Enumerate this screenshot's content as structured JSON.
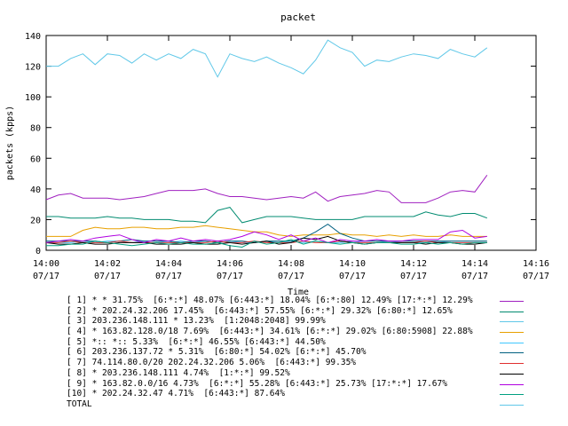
{
  "chart_data": {
    "type": "line",
    "title": "packet",
    "xlabel": "Time",
    "ylabel": "packets (kpps)",
    "ylim": [
      0,
      140
    ],
    "yticks": [
      0,
      20,
      40,
      60,
      80,
      100,
      120,
      140
    ],
    "xticks": [
      {
        "time": "14:00",
        "date": "07/17"
      },
      {
        "time": "14:02",
        "date": "07/17"
      },
      {
        "time": "14:04",
        "date": "07/17"
      },
      {
        "time": "14:06",
        "date": "07/17"
      },
      {
        "time": "14:08",
        "date": "07/17"
      },
      {
        "time": "14:10",
        "date": "07/17"
      },
      {
        "time": "14:12",
        "date": "07/17"
      },
      {
        "time": "14:14",
        "date": "07/17"
      },
      {
        "time": "14:16",
        "date": "07/17"
      }
    ],
    "x_minutes": [
      0,
      0.4,
      0.8,
      1.2,
      1.6,
      2,
      2.4,
      2.8,
      3.2,
      3.6,
      4,
      4.4,
      4.8,
      5.2,
      5.6,
      6,
      6.4,
      6.8,
      7.2,
      7.6,
      8,
      8.4,
      8.8,
      9.2,
      9.6,
      10,
      10.4,
      10.8,
      11.2,
      11.6,
      12,
      12.4,
      12.8,
      13.2,
      13.6,
      14,
      14.4
    ],
    "grid": false,
    "legend_position": "bottom",
    "series": [
      {
        "name": "[ 1] * * 31.75%  [6:*:*] 48.07% [6:443:*] 18.04% [6:*:80] 12.49% [17:*:*] 12.29%",
        "color": "#a020c0",
        "values": [
          33,
          36,
          37,
          34,
          34,
          34,
          33,
          34,
          35,
          37,
          39,
          39,
          39,
          40,
          37,
          35,
          35,
          34,
          33,
          34,
          35,
          34,
          38,
          32,
          35,
          36,
          37,
          39,
          38,
          31,
          31,
          31,
          34,
          38,
          39,
          38,
          49
        ]
      },
      {
        "name": "[ 2] * 202.24.32.206 17.45%  [6:443:*] 57.55% [6:*:*] 29.32% [6:80:*] 12.65%",
        "color": "#008b70",
        "values": [
          22,
          22,
          21,
          21,
          21,
          22,
          21,
          21,
          20,
          20,
          20,
          19,
          19,
          18,
          26,
          28,
          18,
          20,
          22,
          22,
          22,
          21,
          20,
          20,
          20,
          20,
          22,
          22,
          22,
          22,
          22,
          25,
          23,
          22,
          24,
          24,
          21
        ]
      },
      {
        "name": "[ 3] 203.236.148.111 * 13.23%  [1:2048:2048] 99.99%",
        "color": "#60c8e8",
        "values": [
          120,
          120,
          125,
          128,
          121,
          128,
          127,
          122,
          128,
          124,
          128,
          125,
          131,
          128,
          113,
          128,
          125,
          123,
          126,
          122,
          119,
          115,
          124,
          137,
          132,
          129,
          120,
          124,
          123,
          126,
          128,
          127,
          125,
          131,
          128,
          126,
          132
        ]
      },
      {
        "name": "[ 4] * 163.82.128.0/18 7.69%  [6:443:*] 34.61% [6:*:*] 29.02% [6:80:5908] 22.88%",
        "color": "#e8a000",
        "values": [
          9,
          9,
          9,
          13,
          15,
          14,
          14,
          15,
          15,
          14,
          14,
          15,
          15,
          16,
          15,
          14,
          13,
          12,
          12,
          10,
          9,
          10,
          10,
          10,
          11,
          10,
          10,
          9,
          10,
          9,
          10,
          9,
          9,
          10,
          9,
          9,
          9
        ]
      },
      {
        "name": "[ 5] *:: *:: 5.33%  [6:*:*] 46.55% [6:443:*] 44.50%",
        "color": "#40c8ff",
        "values": [
          5,
          5,
          5,
          6,
          5,
          6,
          6,
          5,
          6,
          6,
          5,
          6,
          5,
          6,
          5,
          6,
          5,
          5,
          6,
          5,
          6,
          5,
          6,
          5,
          5,
          6,
          5,
          5,
          6,
          5,
          5,
          5,
          6,
          5,
          5,
          5,
          5
        ]
      },
      {
        "name": "[ 6] 203.236.137.72 * 5.31%  [6:80:*] 54.02% [6:*:*] 45.70%",
        "color": "#006080",
        "values": [
          6,
          6,
          6,
          6,
          6,
          5,
          6,
          7,
          6,
          6,
          6,
          5,
          6,
          6,
          5,
          6,
          6,
          5,
          6,
          6,
          6,
          8,
          12,
          17,
          11,
          8,
          6,
          6,
          6,
          6,
          6,
          6,
          6,
          6,
          6,
          6,
          6
        ]
      },
      {
        "name": "[ 7] 74.114.80.0/20 202.24.32.206 5.06%  [6:443:*] 99.35%",
        "color": "#e03030",
        "values": [
          5,
          5,
          6,
          5,
          5,
          5,
          6,
          5,
          5,
          5,
          5,
          5,
          5,
          5,
          6,
          5,
          5,
          6,
          5,
          5,
          5,
          6,
          5,
          5,
          6,
          5,
          5,
          5,
          5,
          5,
          5,
          6,
          5,
          5,
          5,
          5,
          5
        ]
      },
      {
        "name": "[ 8] * 203.236.148.111 4.74%  [1:*:*] 99.52%",
        "color": "#000000",
        "values": [
          5,
          4,
          4,
          5,
          4,
          4,
          5,
          5,
          5,
          4,
          4,
          4,
          5,
          4,
          4,
          5,
          4,
          5,
          6,
          4,
          5,
          8,
          7,
          9,
          6,
          5,
          4,
          5,
          5,
          5,
          5,
          4,
          5,
          5,
          4,
          4,
          5
        ]
      },
      {
        "name": "[ 9] * 163.82.0.0/16 4.73%  [6:*:*] 55.28% [6:443:*] 25.73% [17:*:*] 17.67%",
        "color": "#b000e0",
        "values": [
          5,
          6,
          7,
          6,
          8,
          9,
          10,
          7,
          5,
          7,
          6,
          8,
          6,
          7,
          6,
          7,
          9,
          12,
          10,
          7,
          10,
          6,
          8,
          5,
          7,
          6,
          6,
          7,
          6,
          6,
          7,
          7,
          7,
          12,
          13,
          8,
          9
        ]
      },
      {
        "name": "[10] * 202.24.32.47 4.71%  [6:443:*] 87.64%",
        "color": "#00a080",
        "values": [
          3,
          3,
          4,
          4,
          6,
          5,
          4,
          3,
          4,
          5,
          4,
          5,
          4,
          4,
          5,
          3,
          2,
          6,
          4,
          5,
          7,
          4,
          6,
          5,
          4,
          5,
          4,
          5,
          5,
          4,
          4,
          5,
          4,
          5,
          4,
          5,
          5
        ]
      },
      {
        "name": "TOTAL",
        "color": "#60c8e8",
        "values": []
      }
    ]
  }
}
